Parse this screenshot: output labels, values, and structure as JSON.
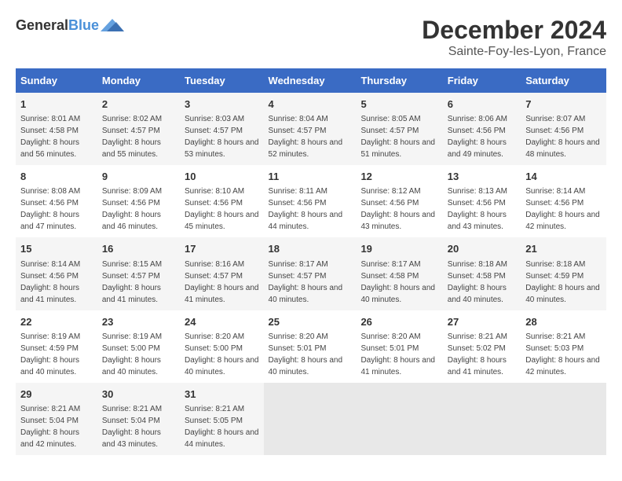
{
  "header": {
    "logo_general": "General",
    "logo_blue": "Blue",
    "month": "December 2024",
    "location": "Sainte-Foy-les-Lyon, France"
  },
  "days_of_week": [
    "Sunday",
    "Monday",
    "Tuesday",
    "Wednesday",
    "Thursday",
    "Friday",
    "Saturday"
  ],
  "weeks": [
    [
      {
        "day": "1",
        "sunrise": "8:01 AM",
        "sunset": "4:58 PM",
        "daylight": "8 hours and 56 minutes."
      },
      {
        "day": "2",
        "sunrise": "8:02 AM",
        "sunset": "4:57 PM",
        "daylight": "8 hours and 55 minutes."
      },
      {
        "day": "3",
        "sunrise": "8:03 AM",
        "sunset": "4:57 PM",
        "daylight": "8 hours and 53 minutes."
      },
      {
        "day": "4",
        "sunrise": "8:04 AM",
        "sunset": "4:57 PM",
        "daylight": "8 hours and 52 minutes."
      },
      {
        "day": "5",
        "sunrise": "8:05 AM",
        "sunset": "4:57 PM",
        "daylight": "8 hours and 51 minutes."
      },
      {
        "day": "6",
        "sunrise": "8:06 AM",
        "sunset": "4:56 PM",
        "daylight": "8 hours and 49 minutes."
      },
      {
        "day": "7",
        "sunrise": "8:07 AM",
        "sunset": "4:56 PM",
        "daylight": "8 hours and 48 minutes."
      }
    ],
    [
      {
        "day": "8",
        "sunrise": "8:08 AM",
        "sunset": "4:56 PM",
        "daylight": "8 hours and 47 minutes."
      },
      {
        "day": "9",
        "sunrise": "8:09 AM",
        "sunset": "4:56 PM",
        "daylight": "8 hours and 46 minutes."
      },
      {
        "day": "10",
        "sunrise": "8:10 AM",
        "sunset": "4:56 PM",
        "daylight": "8 hours and 45 minutes."
      },
      {
        "day": "11",
        "sunrise": "8:11 AM",
        "sunset": "4:56 PM",
        "daylight": "8 hours and 44 minutes."
      },
      {
        "day": "12",
        "sunrise": "8:12 AM",
        "sunset": "4:56 PM",
        "daylight": "8 hours and 43 minutes."
      },
      {
        "day": "13",
        "sunrise": "8:13 AM",
        "sunset": "4:56 PM",
        "daylight": "8 hours and 43 minutes."
      },
      {
        "day": "14",
        "sunrise": "8:14 AM",
        "sunset": "4:56 PM",
        "daylight": "8 hours and 42 minutes."
      }
    ],
    [
      {
        "day": "15",
        "sunrise": "8:14 AM",
        "sunset": "4:56 PM",
        "daylight": "8 hours and 41 minutes."
      },
      {
        "day": "16",
        "sunrise": "8:15 AM",
        "sunset": "4:57 PM",
        "daylight": "8 hours and 41 minutes."
      },
      {
        "day": "17",
        "sunrise": "8:16 AM",
        "sunset": "4:57 PM",
        "daylight": "8 hours and 41 minutes."
      },
      {
        "day": "18",
        "sunrise": "8:17 AM",
        "sunset": "4:57 PM",
        "daylight": "8 hours and 40 minutes."
      },
      {
        "day": "19",
        "sunrise": "8:17 AM",
        "sunset": "4:58 PM",
        "daylight": "8 hours and 40 minutes."
      },
      {
        "day": "20",
        "sunrise": "8:18 AM",
        "sunset": "4:58 PM",
        "daylight": "8 hours and 40 minutes."
      },
      {
        "day": "21",
        "sunrise": "8:18 AM",
        "sunset": "4:59 PM",
        "daylight": "8 hours and 40 minutes."
      }
    ],
    [
      {
        "day": "22",
        "sunrise": "8:19 AM",
        "sunset": "4:59 PM",
        "daylight": "8 hours and 40 minutes."
      },
      {
        "day": "23",
        "sunrise": "8:19 AM",
        "sunset": "5:00 PM",
        "daylight": "8 hours and 40 minutes."
      },
      {
        "day": "24",
        "sunrise": "8:20 AM",
        "sunset": "5:00 PM",
        "daylight": "8 hours and 40 minutes."
      },
      {
        "day": "25",
        "sunrise": "8:20 AM",
        "sunset": "5:01 PM",
        "daylight": "8 hours and 40 minutes."
      },
      {
        "day": "26",
        "sunrise": "8:20 AM",
        "sunset": "5:01 PM",
        "daylight": "8 hours and 41 minutes."
      },
      {
        "day": "27",
        "sunrise": "8:21 AM",
        "sunset": "5:02 PM",
        "daylight": "8 hours and 41 minutes."
      },
      {
        "day": "28",
        "sunrise": "8:21 AM",
        "sunset": "5:03 PM",
        "daylight": "8 hours and 42 minutes."
      }
    ],
    [
      {
        "day": "29",
        "sunrise": "8:21 AM",
        "sunset": "5:04 PM",
        "daylight": "8 hours and 42 minutes."
      },
      {
        "day": "30",
        "sunrise": "8:21 AM",
        "sunset": "5:04 PM",
        "daylight": "8 hours and 43 minutes."
      },
      {
        "day": "31",
        "sunrise": "8:21 AM",
        "sunset": "5:05 PM",
        "daylight": "8 hours and 44 minutes."
      },
      null,
      null,
      null,
      null
    ]
  ]
}
